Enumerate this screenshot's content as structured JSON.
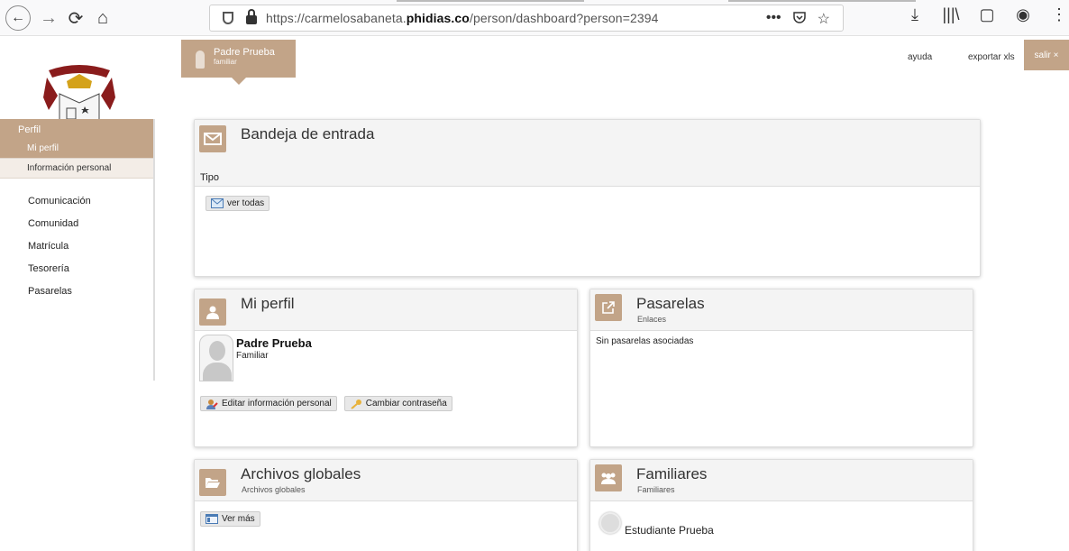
{
  "browser": {
    "url_plain": "https://carmelosabaneta.",
    "url_domain": "phidias.co",
    "url_path": "/person/dashboard?person=2394",
    "page_actions_icon": "•••",
    "pocket_icon": "pocket-icon",
    "bookmark_icon": "star-icon"
  },
  "user": {
    "name": "Padre Prueba",
    "role": "familiar"
  },
  "top_links": {
    "help": "ayuda",
    "export": "exportar xls",
    "logout": "salir ×"
  },
  "sidebar": {
    "section": "Perfil",
    "sub_items": [
      "Mi perfil",
      "Información personal"
    ],
    "items": [
      "Comunicación",
      "Comunidad",
      "Matrícula",
      "Tesorería",
      "Pasarelas"
    ]
  },
  "inbox": {
    "title": "Bandeja de entrada",
    "filter_label": "Tipo",
    "view_all": "ver todas"
  },
  "profile": {
    "title": "Mi perfil",
    "name": "Padre Prueba",
    "role": "Familiar",
    "edit_button": "Editar información personal",
    "password_button": "Cambiar contraseña"
  },
  "gateways": {
    "title": "Pasarelas",
    "subtitle": "Enlaces",
    "empty": "Sin pasarelas asociadas"
  },
  "files": {
    "title": "Archivos globales",
    "subtitle": "Archivos globales",
    "more": "Ver más"
  },
  "family": {
    "title": "Familiares",
    "subtitle": "Familiares",
    "members": [
      "Estudiante Prueba"
    ]
  },
  "colors": {
    "accent": "#c2a488",
    "panel_header": "#f4f4f4"
  }
}
